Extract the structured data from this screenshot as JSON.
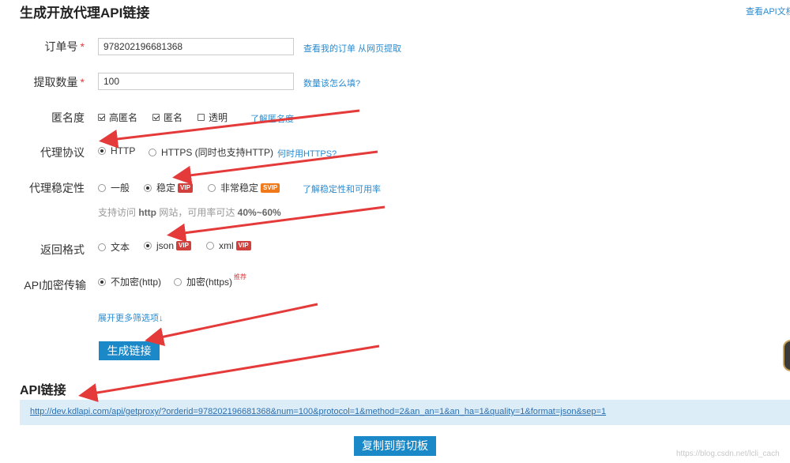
{
  "header": {
    "title": "生成开放代理API链接",
    "doc_link": "查看API文档"
  },
  "form": {
    "order": {
      "label": "订单号",
      "value": "978202196681368",
      "links": [
        "查看我的订单",
        "从网页提取"
      ]
    },
    "quantity": {
      "label": "提取数量",
      "value": "100",
      "help": "数量该怎么填?"
    },
    "anonymity": {
      "label": "匿名度",
      "options": [
        "高匿名",
        "匿名",
        "透明"
      ],
      "checked": [
        true,
        true,
        false
      ],
      "help": "了解匿名度"
    },
    "protocol": {
      "label": "代理协议",
      "options": [
        "HTTP",
        "HTTPS (同时也支持HTTP)"
      ],
      "selected": "HTTP",
      "help": "何时用HTTPS?"
    },
    "stability": {
      "label": "代理稳定性",
      "options": [
        "一般",
        "稳定",
        "非常稳定"
      ],
      "badges": [
        "",
        "VIP",
        "SVIP"
      ],
      "selected": "稳定",
      "help": "了解稳定性和可用率",
      "hint_prefix": "支持访问 ",
      "hint_bold1": "http",
      "hint_mid": " 网站，可用率可达 ",
      "hint_bold2": "40%~60%"
    },
    "format": {
      "label": "返回格式",
      "options": [
        "文本",
        "json",
        "xml"
      ],
      "badges": [
        "",
        "VIP",
        "VIP"
      ],
      "selected": "json"
    },
    "encryption": {
      "label": "API加密传输",
      "options": [
        "不加密(http)",
        "加密(https)"
      ],
      "selected": "不加密(http)",
      "recommend": "推荐"
    },
    "more_options": "展开更多筛选项↓",
    "generate_button": "生成链接"
  },
  "api": {
    "title": "API链接",
    "url": "http://dev.kdlapi.com/api/getproxy/?orderid=978202196681368&num=100&protocol=1&method=2&an_an=1&an_ha=1&quality=1&format=json&sep=1",
    "copy_button": "复制到剪切板"
  },
  "watermark": "https://blog.csdn.net/lcli_cach",
  "colors": {
    "accent": "#1b88c8",
    "link": "#2a8bd0",
    "required": "#e4393c",
    "vip": "#d0403d",
    "svip": "#f07a1a",
    "arrow": "#e53a3a",
    "url_bg": "#dcedf7"
  }
}
